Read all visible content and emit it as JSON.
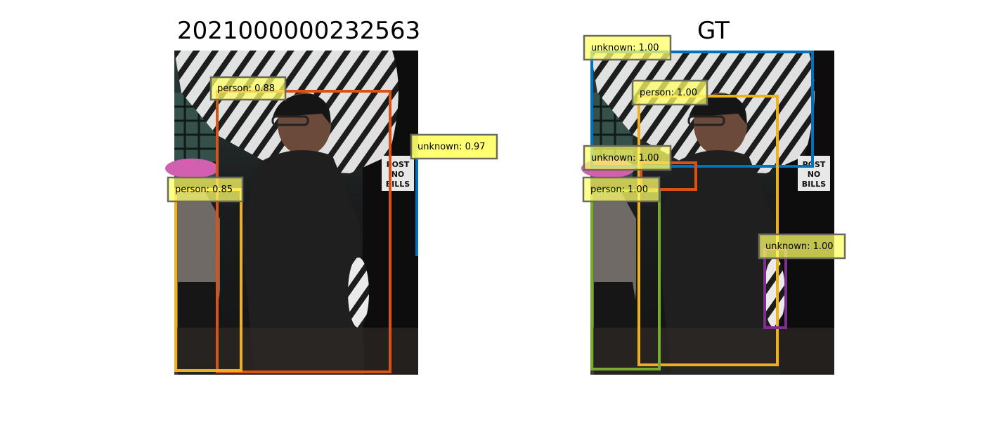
{
  "left_panel": {
    "title": "2021000000232563",
    "detections": [
      {
        "label": "person: 0.88",
        "color": "#d95319"
      },
      {
        "label": "person: 0.85",
        "color": "#edb120"
      },
      {
        "label": "unknown: 0.97",
        "color": "#0072bd"
      }
    ]
  },
  "right_panel": {
    "title": "GT",
    "detections": [
      {
        "label": "unknown: 1.00",
        "color": "#0072bd"
      },
      {
        "label": "person: 1.00",
        "color": "#edb120"
      },
      {
        "label": "unknown: 1.00",
        "color": "#d95319"
      },
      {
        "label": "person: 1.00",
        "color": "#77ac30"
      },
      {
        "label": "unknown: 1.00",
        "color": "#7e2f8e"
      }
    ]
  },
  "colors": {
    "label_fill": "#ffff66",
    "label_border": "#6b6b5a"
  }
}
